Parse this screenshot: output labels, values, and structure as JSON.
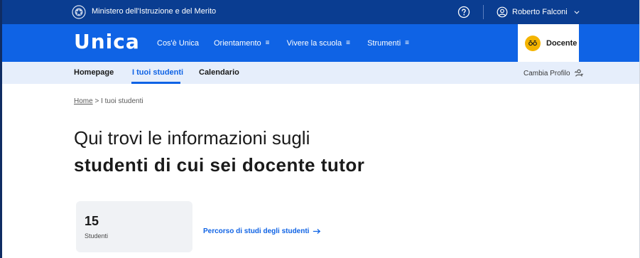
{
  "topbar": {
    "ministry": "Ministero dell'Istruzione e del Merito",
    "user_name": "Roberto Falconi",
    "emblem_icon": "republic-emblem-icon",
    "help_icon": "help-circle-icon",
    "user_icon": "user-circle-icon",
    "chevron_icon": "chevron-down-icon"
  },
  "mainnav": {
    "logo": "Unica",
    "links": [
      {
        "label": "Cos'è Unica",
        "has_menu": false
      },
      {
        "label": "Orientamento",
        "has_menu": true
      },
      {
        "label": "Vivere la scuola",
        "has_menu": true
      },
      {
        "label": "Strumenti",
        "has_menu": true
      }
    ],
    "role": "Docente",
    "role_icon": "teacher-glasses-icon"
  },
  "subnav": {
    "items": [
      {
        "label": "Homepage",
        "active": false
      },
      {
        "label": "I tuoi studenti",
        "active": true
      },
      {
        "label": "Calendario",
        "active": false
      }
    ],
    "profile_label": "Cambia Profilo",
    "profile_icon": "switch-profile-icon"
  },
  "breadcrumb": {
    "home": "Home",
    "separator": ">",
    "current": "I tuoi studenti"
  },
  "heading": {
    "line1": "Qui trovi le informazioni sugli",
    "line2": "studenti di cui sei docente tutor"
  },
  "stats": {
    "count": "15",
    "label": "Studenti"
  },
  "action_link": {
    "label": "Percorso di studi degli studenti",
    "icon": "arrow-right-icon"
  },
  "colors": {
    "topbar": "#0a3d91",
    "mainbar": "#0f63e5",
    "subbar": "#e6eefb",
    "accent": "#0f63e5",
    "badge": "#f4b400"
  }
}
